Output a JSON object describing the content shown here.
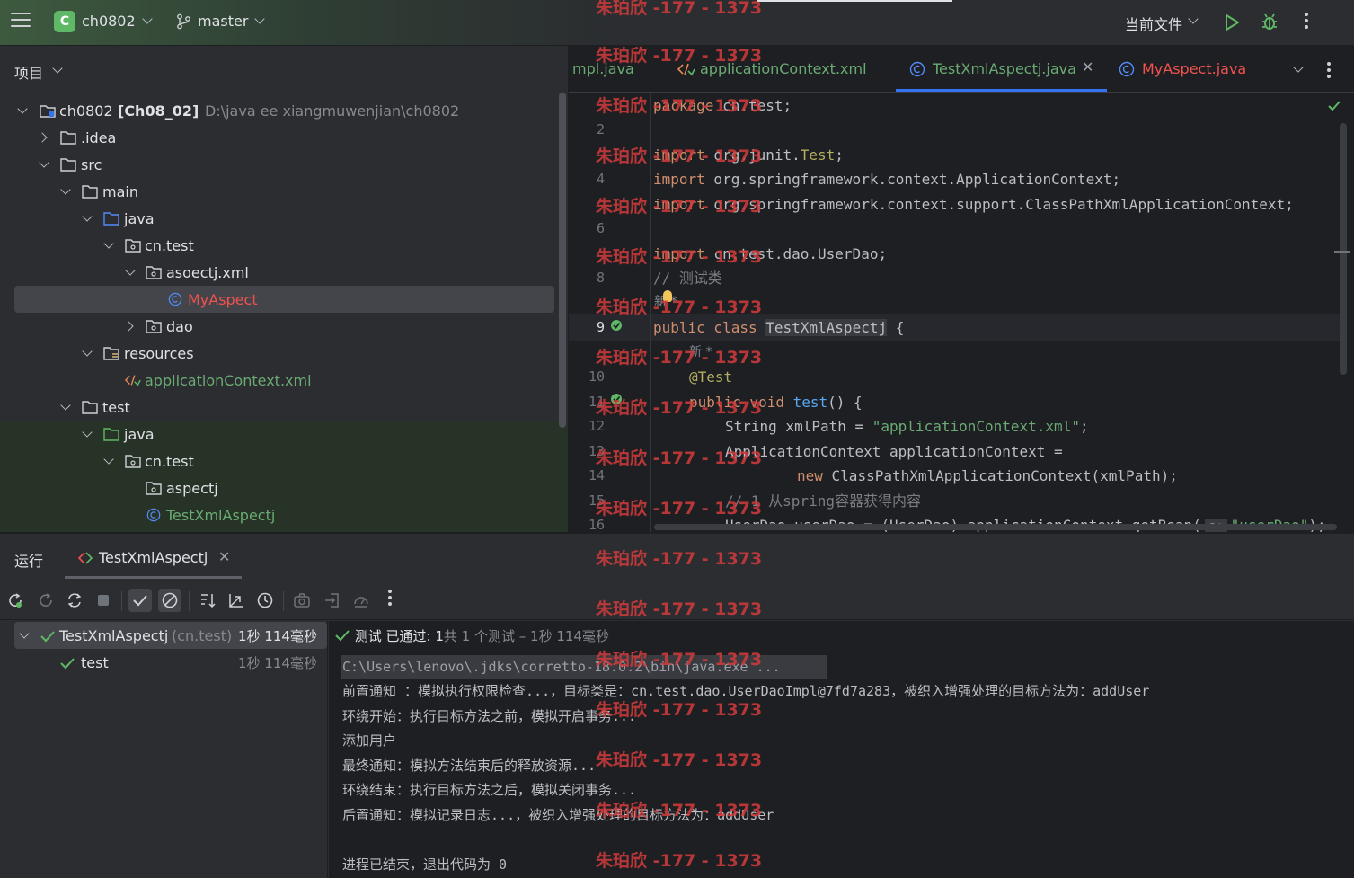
{
  "titlebar": {
    "project_badge": "C",
    "project_name": "ch0802",
    "branch": "master",
    "current_file": "当前文件"
  },
  "project_panel": {
    "title": "项目",
    "tree": [
      {
        "label": "ch0802",
        "suffix": "[Ch08_02]",
        "path": "D:\\java ee xiangmuwenjian\\ch0802"
      },
      {
        "label": ".idea"
      },
      {
        "label": "src"
      },
      {
        "label": "main"
      },
      {
        "label": "java"
      },
      {
        "label": "cn.test"
      },
      {
        "label": "asoectj.xml"
      },
      {
        "label": "MyAspect"
      },
      {
        "label": "dao"
      },
      {
        "label": "resources"
      },
      {
        "label": "applicationContext.xml"
      },
      {
        "label": "test"
      },
      {
        "label": "java"
      },
      {
        "label": "cn.test"
      },
      {
        "label": "aspectj"
      },
      {
        "label": "TestXmlAspectj"
      }
    ]
  },
  "editor": {
    "tabs": [
      {
        "label": "mpl.java"
      },
      {
        "label": "applicationContext.xml"
      },
      {
        "label": "TestXmlAspectj.java"
      },
      {
        "label": "MyAspect.java"
      }
    ],
    "line_numbers": [
      "",
      "2",
      "",
      "4",
      "",
      "6",
      "",
      "8",
      "",
      "9",
      "",
      "10",
      "11",
      "12",
      "13",
      "14",
      "15",
      "16"
    ],
    "code": {
      "l1": [
        "package",
        " cn.test;"
      ],
      "l3": [
        "import",
        " org.junit.",
        "Test",
        ";"
      ],
      "l4": [
        "import",
        " org.springframework.context.ApplicationContext;"
      ],
      "l5": [
        "import",
        " org.springframework.context.support.ClassPathXmlApplicationContext;"
      ],
      "l7": [
        "import",
        " cn.test.dao.UserDao;"
      ],
      "l8": "// 测试类",
      "hint1": "新 *",
      "l9": [
        "public",
        " class ",
        "TestXmlAspectj",
        " {"
      ],
      "hint2": "新 *",
      "l10": "@Test",
      "l11": [
        "public",
        " void ",
        "test",
        "() {"
      ],
      "l12": [
        "String xmlPath = ",
        "\"applicationContext.xml\"",
        ";"
      ],
      "l13": "ApplicationContext applicationContext =",
      "l14": [
        "new",
        " ClassPathXmlApplicationContext(xmlPath);"
      ],
      "l15": "// 1 从spring容器获得内容",
      "l16": [
        "UserDao userDao = (UserDao) applicationContext.getBean(",
        "s:",
        "\"userDao\"",
        ");"
      ]
    }
  },
  "run_panel": {
    "title": "运行",
    "tab": "TestXmlAspectj",
    "tests": [
      {
        "name": "TestXmlAspectj",
        "pkg": "(cn.test)",
        "time": "1秒 114毫秒"
      },
      {
        "name": "test",
        "time": "1秒 114毫秒"
      }
    ],
    "status_passed": "测试 已通过: 1",
    "status_detail": "共 1 个测试 – 1秒 114毫秒",
    "console": [
      "C:\\Users\\lenovo\\.jdks\\corretto-18.0.2\\bin\\java.exe ...",
      "前置通知 ：模拟执行权限检查...，目标类是：cn.test.dao.UserDaoImpl@7fd7a283，被织入增强处理的目标方法为：addUser",
      "环绕开始：执行目标方法之前，模拟开启事务...",
      "添加用户",
      "最终通知：模拟方法结束后的释放资源...",
      "环绕结束：执行目标方法之后，模拟关闭事务...",
      "后置通知：模拟记录日志...，被织入增强处理的目标方法为：addUser",
      "",
      "进程已结束，退出代码为 0"
    ]
  },
  "watermark": "朱珀欣 -177 - 1373",
  "colors": {
    "accent": "#3574f0",
    "keyword": "#cf8e6d",
    "string": "#6aab73",
    "pass": "#5fb865",
    "watermark": "#d23c3c"
  }
}
